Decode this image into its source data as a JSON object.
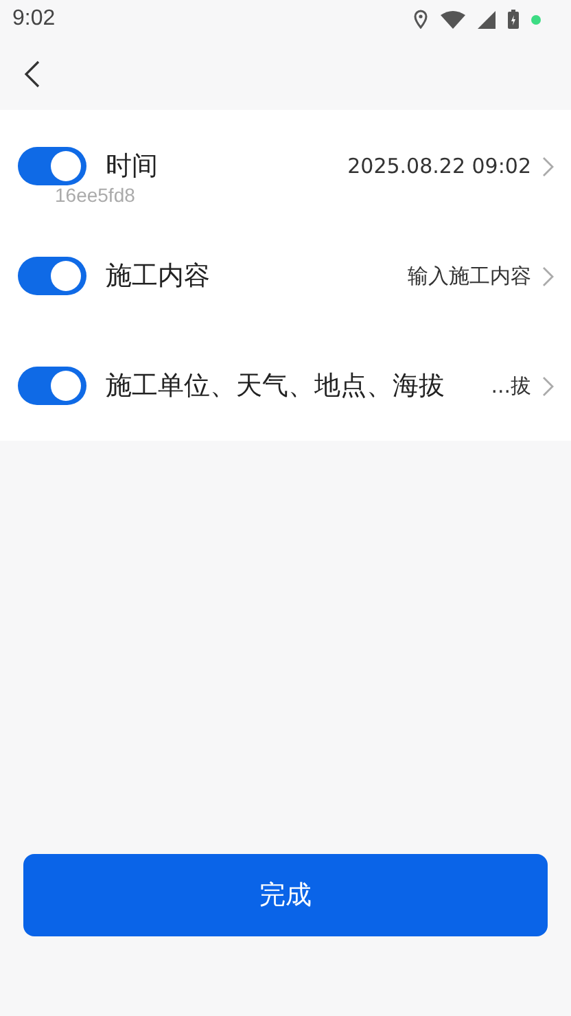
{
  "status_bar": {
    "time": "9:02"
  },
  "rows": [
    {
      "label": "时间",
      "on": true,
      "value": "2025.08.22 09:02",
      "sub": "16ee5fd8"
    },
    {
      "label": "施工内容",
      "on": true,
      "value": "输入施工内容"
    },
    {
      "label": "施工单位、天气、地点、海拔",
      "on": true,
      "value": "...拔"
    }
  ],
  "done_button": "完成"
}
